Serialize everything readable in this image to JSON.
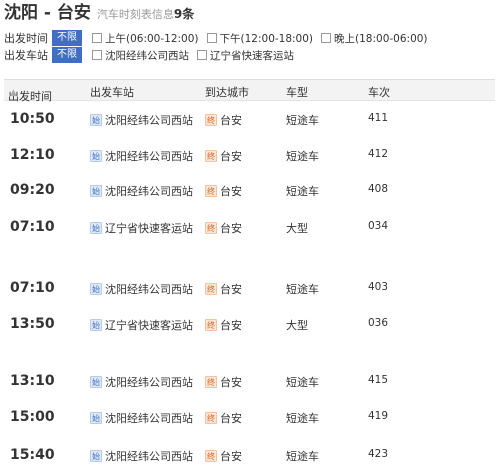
{
  "title": {
    "route": "沈阳 - 台安",
    "subtitle": "汽车时刻表信息",
    "count": "9条"
  },
  "filters": {
    "time": {
      "label": "出发时间",
      "all": "不限",
      "options": [
        "上午(06:00-12:00)",
        "下午(12:00-18:00)",
        "晚上(18:00-06:00)"
      ]
    },
    "station": {
      "label": "出发车站",
      "all": "不限",
      "options": [
        "沈阳经纬公司西站",
        "辽宁省快速客运站"
      ]
    }
  },
  "table": {
    "headers": [
      "出发时间",
      "出发车站",
      "到达城市",
      "车型",
      "车次"
    ],
    "dep_icon": "始",
    "arr_icon": "终",
    "rows": [
      {
        "time": "10:50",
        "station": "沈阳经纬公司西站",
        "city": "台安",
        "type": "短途车",
        "num": "411"
      },
      {
        "time": "12:10",
        "station": "沈阳经纬公司西站",
        "city": "台安",
        "type": "短途车",
        "num": "412"
      },
      {
        "time": "09:20",
        "station": "沈阳经纬公司西站",
        "city": "台安",
        "type": "短途车",
        "num": "408"
      },
      {
        "time": "07:10",
        "station": "辽宁省快速客运站",
        "city": "台安",
        "type": "大型",
        "num": "034"
      },
      {
        "time": "07:10",
        "station": "沈阳经纬公司西站",
        "city": "台安",
        "type": "短途车",
        "num": "403"
      },
      {
        "time": "13:50",
        "station": "辽宁省快速客运站",
        "city": "台安",
        "type": "大型",
        "num": "036"
      },
      {
        "time": "13:10",
        "station": "沈阳经纬公司西站",
        "city": "台安",
        "type": "短途车",
        "num": "415"
      },
      {
        "time": "15:00",
        "station": "沈阳经纬公司西站",
        "city": "台安",
        "type": "短途车",
        "num": "419"
      },
      {
        "time": "15:40",
        "station": "沈阳经纬公司西站",
        "city": "台安",
        "type": "短途车",
        "num": "423"
      }
    ]
  },
  "colors": {
    "accent": "#3f6ec4",
    "dep_icon": "#3a6fc3",
    "arr_icon": "#d4601d"
  }
}
